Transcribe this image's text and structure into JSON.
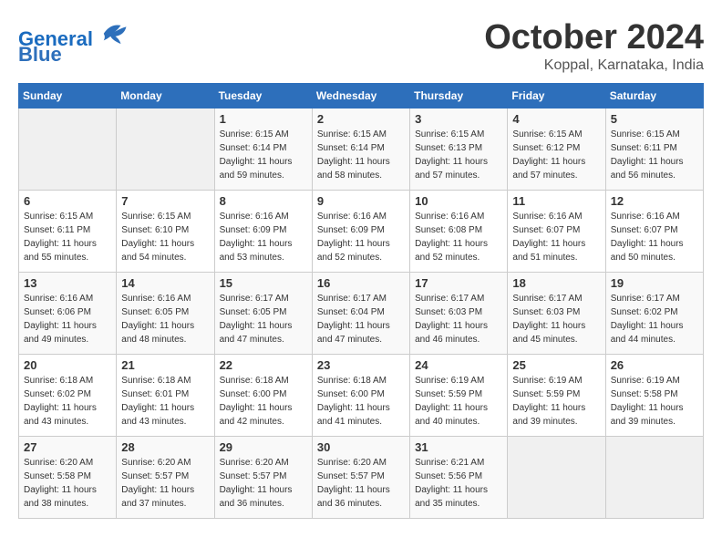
{
  "header": {
    "logo_line1": "General",
    "logo_line2": "Blue",
    "month_title": "October 2024",
    "location": "Koppal, Karnataka, India"
  },
  "days_of_week": [
    "Sunday",
    "Monday",
    "Tuesday",
    "Wednesday",
    "Thursday",
    "Friday",
    "Saturday"
  ],
  "weeks": [
    [
      {
        "day": "",
        "info": ""
      },
      {
        "day": "",
        "info": ""
      },
      {
        "day": "1",
        "info": "Sunrise: 6:15 AM\nSunset: 6:14 PM\nDaylight: 11 hours\nand 59 minutes."
      },
      {
        "day": "2",
        "info": "Sunrise: 6:15 AM\nSunset: 6:14 PM\nDaylight: 11 hours\nand 58 minutes."
      },
      {
        "day": "3",
        "info": "Sunrise: 6:15 AM\nSunset: 6:13 PM\nDaylight: 11 hours\nand 57 minutes."
      },
      {
        "day": "4",
        "info": "Sunrise: 6:15 AM\nSunset: 6:12 PM\nDaylight: 11 hours\nand 57 minutes."
      },
      {
        "day": "5",
        "info": "Sunrise: 6:15 AM\nSunset: 6:11 PM\nDaylight: 11 hours\nand 56 minutes."
      }
    ],
    [
      {
        "day": "6",
        "info": "Sunrise: 6:15 AM\nSunset: 6:11 PM\nDaylight: 11 hours\nand 55 minutes."
      },
      {
        "day": "7",
        "info": "Sunrise: 6:15 AM\nSunset: 6:10 PM\nDaylight: 11 hours\nand 54 minutes."
      },
      {
        "day": "8",
        "info": "Sunrise: 6:16 AM\nSunset: 6:09 PM\nDaylight: 11 hours\nand 53 minutes."
      },
      {
        "day": "9",
        "info": "Sunrise: 6:16 AM\nSunset: 6:09 PM\nDaylight: 11 hours\nand 52 minutes."
      },
      {
        "day": "10",
        "info": "Sunrise: 6:16 AM\nSunset: 6:08 PM\nDaylight: 11 hours\nand 52 minutes."
      },
      {
        "day": "11",
        "info": "Sunrise: 6:16 AM\nSunset: 6:07 PM\nDaylight: 11 hours\nand 51 minutes."
      },
      {
        "day": "12",
        "info": "Sunrise: 6:16 AM\nSunset: 6:07 PM\nDaylight: 11 hours\nand 50 minutes."
      }
    ],
    [
      {
        "day": "13",
        "info": "Sunrise: 6:16 AM\nSunset: 6:06 PM\nDaylight: 11 hours\nand 49 minutes."
      },
      {
        "day": "14",
        "info": "Sunrise: 6:16 AM\nSunset: 6:05 PM\nDaylight: 11 hours\nand 48 minutes."
      },
      {
        "day": "15",
        "info": "Sunrise: 6:17 AM\nSunset: 6:05 PM\nDaylight: 11 hours\nand 47 minutes."
      },
      {
        "day": "16",
        "info": "Sunrise: 6:17 AM\nSunset: 6:04 PM\nDaylight: 11 hours\nand 47 minutes."
      },
      {
        "day": "17",
        "info": "Sunrise: 6:17 AM\nSunset: 6:03 PM\nDaylight: 11 hours\nand 46 minutes."
      },
      {
        "day": "18",
        "info": "Sunrise: 6:17 AM\nSunset: 6:03 PM\nDaylight: 11 hours\nand 45 minutes."
      },
      {
        "day": "19",
        "info": "Sunrise: 6:17 AM\nSunset: 6:02 PM\nDaylight: 11 hours\nand 44 minutes."
      }
    ],
    [
      {
        "day": "20",
        "info": "Sunrise: 6:18 AM\nSunset: 6:02 PM\nDaylight: 11 hours\nand 43 minutes."
      },
      {
        "day": "21",
        "info": "Sunrise: 6:18 AM\nSunset: 6:01 PM\nDaylight: 11 hours\nand 43 minutes."
      },
      {
        "day": "22",
        "info": "Sunrise: 6:18 AM\nSunset: 6:00 PM\nDaylight: 11 hours\nand 42 minutes."
      },
      {
        "day": "23",
        "info": "Sunrise: 6:18 AM\nSunset: 6:00 PM\nDaylight: 11 hours\nand 41 minutes."
      },
      {
        "day": "24",
        "info": "Sunrise: 6:19 AM\nSunset: 5:59 PM\nDaylight: 11 hours\nand 40 minutes."
      },
      {
        "day": "25",
        "info": "Sunrise: 6:19 AM\nSunset: 5:59 PM\nDaylight: 11 hours\nand 39 minutes."
      },
      {
        "day": "26",
        "info": "Sunrise: 6:19 AM\nSunset: 5:58 PM\nDaylight: 11 hours\nand 39 minutes."
      }
    ],
    [
      {
        "day": "27",
        "info": "Sunrise: 6:20 AM\nSunset: 5:58 PM\nDaylight: 11 hours\nand 38 minutes."
      },
      {
        "day": "28",
        "info": "Sunrise: 6:20 AM\nSunset: 5:57 PM\nDaylight: 11 hours\nand 37 minutes."
      },
      {
        "day": "29",
        "info": "Sunrise: 6:20 AM\nSunset: 5:57 PM\nDaylight: 11 hours\nand 36 minutes."
      },
      {
        "day": "30",
        "info": "Sunrise: 6:20 AM\nSunset: 5:57 PM\nDaylight: 11 hours\nand 36 minutes."
      },
      {
        "day": "31",
        "info": "Sunrise: 6:21 AM\nSunset: 5:56 PM\nDaylight: 11 hours\nand 35 minutes."
      },
      {
        "day": "",
        "info": ""
      },
      {
        "day": "",
        "info": ""
      }
    ]
  ]
}
